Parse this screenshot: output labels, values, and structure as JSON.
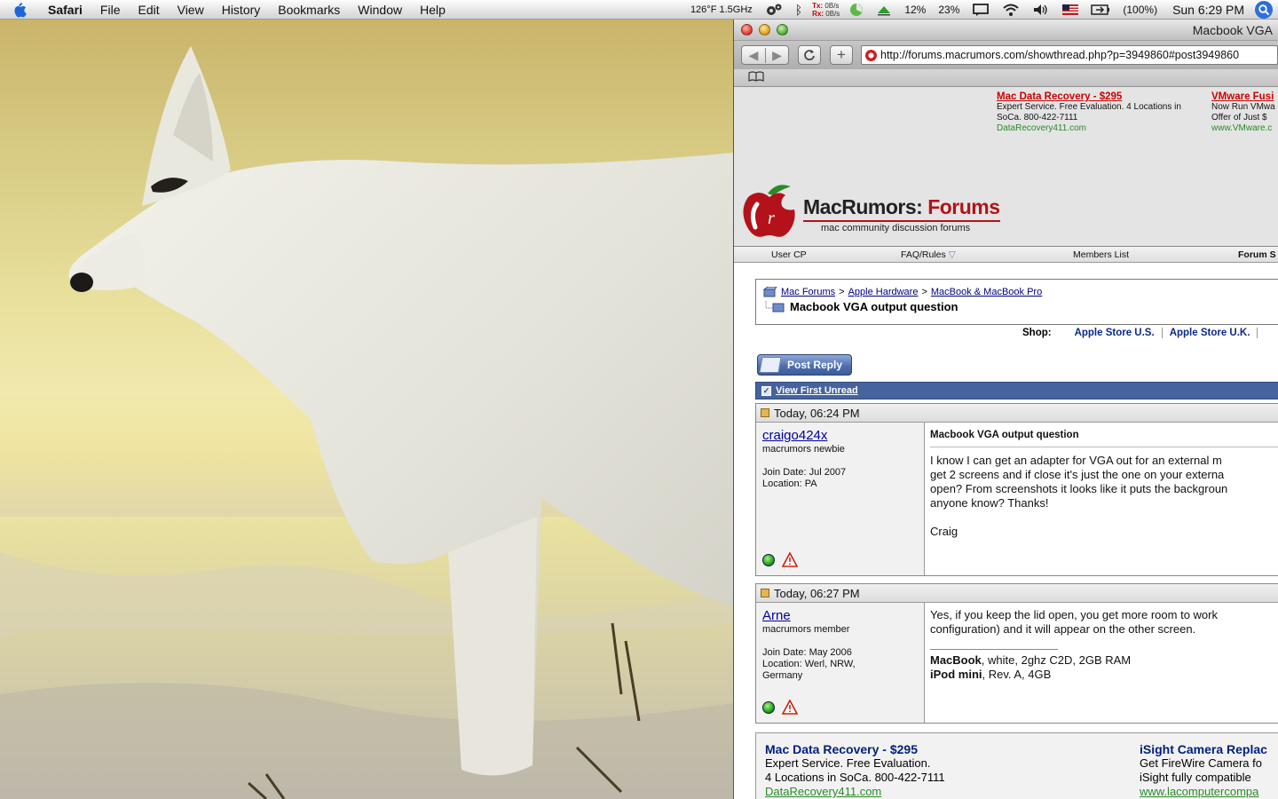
{
  "menubar": {
    "app": "Safari",
    "items": [
      "File",
      "Edit",
      "View",
      "History",
      "Bookmarks",
      "Window",
      "Help"
    ],
    "cpu": "126°F 1.5GHz",
    "tx_label": "Tx:",
    "rx_label": "Rx:",
    "tx_value": "0B/s",
    "rx_value": "0B/s",
    "cpu_pct": "12%",
    "mem_pct": "23%",
    "battery": "(100%)",
    "clock": "Sun 6:29 PM"
  },
  "window": {
    "title": "Macbook VGA",
    "url": "http://forums.macrumors.com/showthread.php?p=3949860#post3949860"
  },
  "top_ads": [
    {
      "title": "Mac Data Recovery - $295",
      "line1": "Expert Service. Free Evaluation. 4 Locations in",
      "line2": "SoCa. 800-422-7111",
      "url": "DataRecovery411.com"
    },
    {
      "title": "VMware Fusi",
      "line1": "Now Run VMwa",
      "line2": "Offer of Just $",
      "url": "www.VMware.c"
    }
  ],
  "logo": {
    "main": "MacRumors:",
    "accent": "Forums",
    "sub": "mac community discussion forums"
  },
  "nav": {
    "user_cp": "User CP",
    "faq": "FAQ/Rules",
    "members": "Members List",
    "forum_search": "Forum S"
  },
  "breadcrumb": {
    "items": [
      "Mac Forums",
      "Apple Hardware",
      "MacBook & MacBook Pro"
    ],
    "separator": ">",
    "thread_title": "Macbook VGA output question"
  },
  "shop": {
    "label": "Shop:",
    "links": [
      "Apple Store U.S.",
      "Apple Store U.K."
    ]
  },
  "post_reply_label": "Post Reply",
  "view_first_unread": "View First Unread",
  "posts": [
    {
      "date": "Today, 06:24 PM",
      "username": "craigo424x",
      "rank": "macrumors newbie",
      "join_date": "Join Date: Jul 2007",
      "location": "Location: PA",
      "title": "Macbook VGA output question",
      "lines": [
        "I know I can get an adapter for VGA out for an external m",
        "get 2 screens and if close it's just the one on your externa",
        "open? From screenshots it looks like it puts the backgroun",
        "anyone know? Thanks!"
      ],
      "signoff": "Craig"
    },
    {
      "date": "Today, 06:27 PM",
      "username": "Arne",
      "rank": "macrumors member",
      "join_date": "Join Date: May 2006",
      "location": "Location: Werl, NRW,",
      "location2": "Germany",
      "lines": [
        "Yes, if you keep the lid open, you get more room to work",
        "configuration) and it will appear on the other screen."
      ],
      "sig1_bold": "MacBook",
      "sig1_rest": ", white, 2ghz C2D, 2GB RAM",
      "sig2_bold": "iPod mini",
      "sig2_rest": ", Rev. A, 4GB"
    }
  ],
  "bottom_ads": [
    {
      "title": "Mac Data Recovery - $295",
      "line1": "Expert Service. Free Evaluation.",
      "line2": "4 Locations in SoCa. 800-422-7111",
      "url": "DataRecovery411.com"
    },
    {
      "title": "iSight Camera Replac",
      "line1": "Get FireWire Camera fo",
      "line2": "iSight fully compatible",
      "url": "www.lacomputercompa"
    }
  ]
}
